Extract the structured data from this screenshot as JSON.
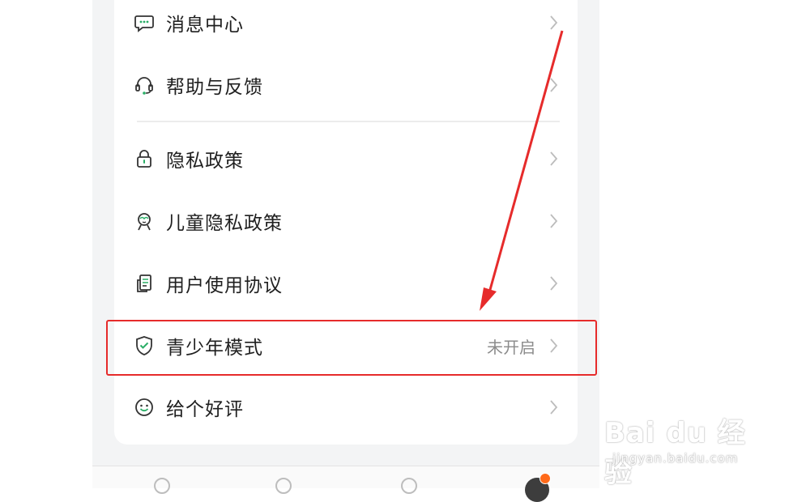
{
  "menu": {
    "items": [
      {
        "label": "消息中心",
        "icon": "message-icon"
      },
      {
        "label": "帮助与反馈",
        "icon": "headset-icon"
      },
      {
        "label": "隐私政策",
        "icon": "lock-icon"
      },
      {
        "label": "儿童隐私政策",
        "icon": "child-icon"
      },
      {
        "label": "用户使用协议",
        "icon": "document-icon"
      },
      {
        "label": "青少年模式",
        "icon": "shield-check-icon",
        "value": "未开启"
      },
      {
        "label": "给个好评",
        "icon": "smile-icon"
      }
    ]
  },
  "colors": {
    "accent": "#2aae67",
    "annotation": "#e62b2b",
    "badge": "#ff6a1a"
  },
  "watermark": {
    "brand": "Bai  du 经验",
    "url": "jingyan.baidu.com"
  }
}
